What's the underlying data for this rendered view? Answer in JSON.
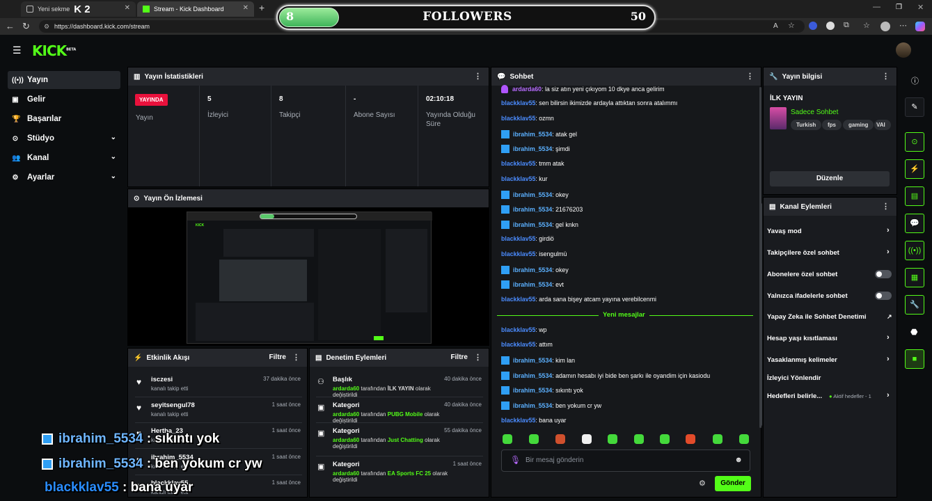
{
  "browser": {
    "tab1_label": "Yeni sekme",
    "tab1_badge": "K 2",
    "tab2_label": "Stream - Kick Dashboard",
    "url": "https://dashboard.kick.com/stream"
  },
  "followers_overlay": {
    "current": "8",
    "title": "FOLLOWERS",
    "goal": "50",
    "progress_fraction": 0.16
  },
  "nav": {
    "logo": "KICK",
    "logo_sup": "BETA",
    "items": [
      {
        "label": "Yayın"
      },
      {
        "label": "Gelir"
      },
      {
        "label": "Başarılar"
      },
      {
        "label": "Stüdyo"
      },
      {
        "label": "Kanal"
      },
      {
        "label": "Ayarlar"
      }
    ]
  },
  "stats": {
    "title": "Yayın İstatistikleri",
    "live_badge": "YAYINDA",
    "live_label": "Yayın",
    "viewers_value": "5",
    "viewers_label": "İzleyici",
    "followers_value": "8",
    "followers_label": "Takipçi",
    "subs_value": "-",
    "subs_label": "Abone Sayısı",
    "uptime_value": "02:10:18",
    "uptime_label": "Yayında Olduğu Süre"
  },
  "preview": {
    "title": "Yayın Ön İzlemesi"
  },
  "chat": {
    "title": "Sohbet",
    "new_messages": "Yeni mesajlar",
    "placeholder": "Bir mesaj gönderin",
    "send": "Gönder",
    "messages": [
      {
        "user": "ardarda60",
        "text": ": la siz atın yeni çıkıyom 10 dkye anca gelirim",
        "color": "#b76bff",
        "badge": "mic"
      },
      {
        "user": "blackklav55",
        "text": ": sen bilirsin ikimizde ardayla attıktan sonra atalımmı",
        "color": "#4b8cff",
        "badge": ""
      },
      {
        "user": "blackklav55",
        "text": ": ozmn",
        "color": "#4b8cff",
        "badge": ""
      },
      {
        "user": "ibrahim_5534",
        "text": ": atak gel",
        "color": "#5bb0ff",
        "badge": "blue"
      },
      {
        "user": "ibrahim_5534",
        "text": ": şimdi",
        "color": "#5bb0ff",
        "badge": "blue"
      },
      {
        "user": "blackklav55",
        "text": ": tmm atak",
        "color": "#4b8cff",
        "badge": ""
      },
      {
        "user": "blackklav55",
        "text": ": kur",
        "color": "#4b8cff",
        "badge": ""
      },
      {
        "user": "ibrahim_5534",
        "text": ": okey",
        "color": "#5bb0ff",
        "badge": "blue"
      },
      {
        "user": "ibrahim_5534",
        "text": ": 21676203",
        "color": "#5bb0ff",
        "badge": "blue"
      },
      {
        "user": "ibrahim_5534",
        "text": ": gel knkn",
        "color": "#5bb0ff",
        "badge": "blue"
      },
      {
        "user": "blackklav55",
        "text": ": girdiö",
        "color": "#4b8cff",
        "badge": ""
      },
      {
        "user": "blackklav55",
        "text": ": isengulmü",
        "color": "#4b8cff",
        "badge": ""
      },
      {
        "user": "ibrahim_5534",
        "text": ": okey",
        "color": "#5bb0ff",
        "badge": "blue"
      },
      {
        "user": "ibrahim_5534",
        "text": ": evt",
        "color": "#5bb0ff",
        "badge": "blue"
      },
      {
        "user": "blackklav55",
        "text": ": arda sana bişey atcam yayına verebilcenmi",
        "color": "#4b8cff",
        "badge": ""
      },
      {
        "user": "blackklav55",
        "text": ": wp",
        "color": "#4b8cff",
        "badge": ""
      },
      {
        "user": "blackklav55",
        "text": ": attım",
        "color": "#4b8cff",
        "badge": ""
      },
      {
        "user": "ibrahim_5534",
        "text": ": kim lan",
        "color": "#5bb0ff",
        "badge": "blue"
      },
      {
        "user": "ibrahim_5534",
        "text": ": adamın hesabı iyi bide ben şarkı ile oyandim için kasiodu",
        "color": "#5bb0ff",
        "badge": "blue"
      },
      {
        "user": "ibrahim_5534",
        "text": ": sıkıntı yok",
        "color": "#5bb0ff",
        "badge": "blue"
      },
      {
        "user": "ibrahim_5534",
        "text": ": ben yokum cr yw",
        "color": "#5bb0ff",
        "badge": "blue"
      },
      {
        "user": "blackklav55",
        "text": ": bana uyar",
        "color": "#4b8cff",
        "badge": ""
      }
    ]
  },
  "stream_info": {
    "title": "Yayın bilgisi",
    "stream_title": "İLK YAYIN",
    "category": "Sadece Sohbet",
    "tags": [
      "Turkish",
      "fps",
      "gaming",
      "VAI"
    ],
    "edit": "Düzenle"
  },
  "channel_actions": {
    "title": "Kanal Eylemleri",
    "items": [
      {
        "label": "Yavaş mod"
      },
      {
        "label": "Takipçilere özel sohbet"
      },
      {
        "label": "Abonelere özel sohbet"
      },
      {
        "label": "Yalnızca ifadelerle sohbet"
      },
      {
        "label": "Yapay Zeka ile Sohbet Denetimi"
      },
      {
        "label": "Hesap yaşı kısıtlaması"
      },
      {
        "label": "Yasaklanmış kelimeler"
      },
      {
        "label": "İzleyici Yönlendir"
      },
      {
        "label": "Hedefleri belirle..."
      }
    ],
    "goals_status": "Aktif hedefler - 1"
  },
  "activity": {
    "title": "Etkinlik Akışı",
    "filter": "Filtre",
    "items": [
      {
        "name": "isczesi",
        "desc": "kanalı takip etti",
        "time": "37 dakika önce"
      },
      {
        "name": "seyitsengul78",
        "desc": "kanalı takip etti",
        "time": "1 saat önce"
      },
      {
        "name": "Hertha_23",
        "desc": "kanalı takip etti",
        "time": "1 saat önce"
      },
      {
        "name": "ibrahim_5534",
        "desc": "kanalı takip etti",
        "time": "1 saat önce"
      },
      {
        "name": "blackklav55",
        "desc": "kanalı takip etti",
        "time": "1 saat önce"
      }
    ]
  },
  "moderation": {
    "title": "Denetim Eylemleri",
    "filter": "Filtre",
    "items": [
      {
        "name": "Başlık",
        "by": "ardarda60",
        "mid": " tarafından ",
        "value": "İLK YAYIN",
        "end": " olarak değiştirildi",
        "time": "40 dakika önce"
      },
      {
        "name": "Kategori",
        "by": "ardarda60",
        "mid": " tarafından ",
        "value": "PUBG Mobile",
        "end": " olarak değiştirildi",
        "time": "40 dakika önce"
      },
      {
        "name": "Kategori",
        "by": "ardarda60",
        "mid": " tarafından ",
        "value": "Just Chatting",
        "end": " olarak değiştirildi",
        "time": "55 dakika önce"
      },
      {
        "name": "Kategori",
        "by": "ardarda60",
        "mid": " tarafından ",
        "value": "EA Sports FC 25",
        "end": " olarak değiştirildi",
        "time": "1 saat önce"
      }
    ]
  },
  "overlay_chat": [
    {
      "user": "ibrahim_5534",
      "text": " : sıkıntı yok",
      "color": "#6fb6ff"
    },
    {
      "user": "ibrahim_5534",
      "text": " : ben yokum cr yw",
      "color": "#6fb6ff"
    },
    {
      "user": "blackklav55",
      "text": " : bana uyar",
      "color": "#2a8dff"
    }
  ]
}
